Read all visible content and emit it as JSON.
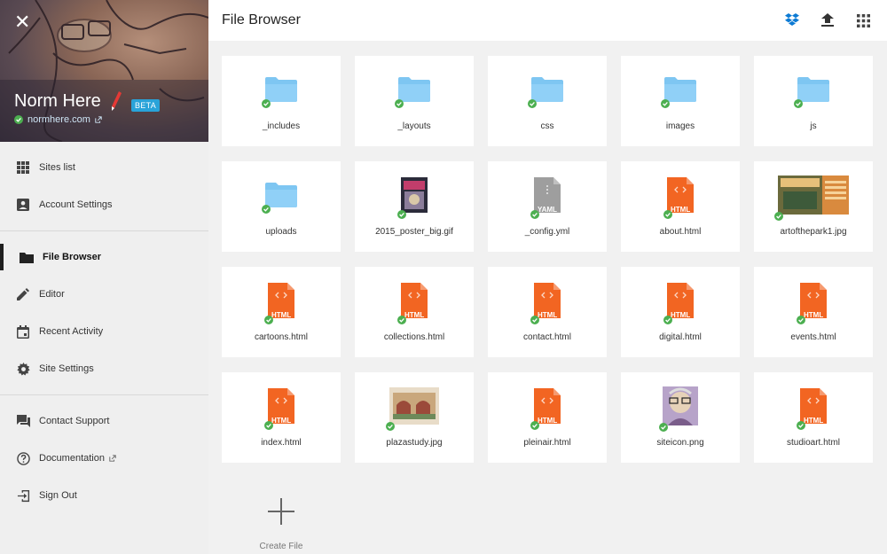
{
  "app": {
    "title": "File Browser"
  },
  "site": {
    "name": "Norm Here",
    "badge": "BETA",
    "url": "normhere.com"
  },
  "colors": {
    "accent": "#29a3d9",
    "status_ok": "#4caf50",
    "html_file": "#f26522",
    "folder": "#7ec6f2",
    "yaml_file": "#9e9e9e"
  },
  "nav": {
    "group1": [
      {
        "label": "Sites list",
        "icon": "grid-icon"
      },
      {
        "label": "Account Settings",
        "icon": "account-icon"
      }
    ],
    "group2": [
      {
        "label": "File Browser",
        "icon": "folder-icon",
        "active": true
      },
      {
        "label": "Editor",
        "icon": "pencil-icon"
      },
      {
        "label": "Recent Activity",
        "icon": "calendar-icon"
      },
      {
        "label": "Site Settings",
        "icon": "gear-icon"
      }
    ],
    "group3": [
      {
        "label": "Contact Support",
        "icon": "chat-icon"
      },
      {
        "label": "Documentation",
        "icon": "help-icon"
      },
      {
        "label": "Sign Out",
        "icon": "sign-out-icon"
      }
    ]
  },
  "toolbar": {
    "icons": [
      "dropbox-icon",
      "upload-icon",
      "apps-grid-icon"
    ]
  },
  "files": [
    {
      "name": "_includes",
      "type": "folder"
    },
    {
      "name": "_layouts",
      "type": "folder"
    },
    {
      "name": "css",
      "type": "folder"
    },
    {
      "name": "images",
      "type": "folder"
    },
    {
      "name": "js",
      "type": "folder"
    },
    {
      "name": "uploads",
      "type": "folder"
    },
    {
      "name": "2015_poster_big.gif",
      "type": "image"
    },
    {
      "name": "_config.yml",
      "type": "yaml",
      "tag": "YAML"
    },
    {
      "name": "about.html",
      "type": "html",
      "tag": "HTML"
    },
    {
      "name": "artofthepark1.jpg",
      "type": "image"
    },
    {
      "name": "cartoons.html",
      "type": "html",
      "tag": "HTML"
    },
    {
      "name": "collections.html",
      "type": "html",
      "tag": "HTML"
    },
    {
      "name": "contact.html",
      "type": "html",
      "tag": "HTML"
    },
    {
      "name": "digital.html",
      "type": "html",
      "tag": "HTML"
    },
    {
      "name": "events.html",
      "type": "html",
      "tag": "HTML"
    },
    {
      "name": "index.html",
      "type": "html",
      "tag": "HTML"
    },
    {
      "name": "plazastudy.jpg",
      "type": "image"
    },
    {
      "name": "pleinair.html",
      "type": "html",
      "tag": "HTML"
    },
    {
      "name": "siteicon.png",
      "type": "image"
    },
    {
      "name": "studioart.html",
      "type": "html",
      "tag": "HTML"
    }
  ],
  "create": {
    "label": "Create File"
  }
}
